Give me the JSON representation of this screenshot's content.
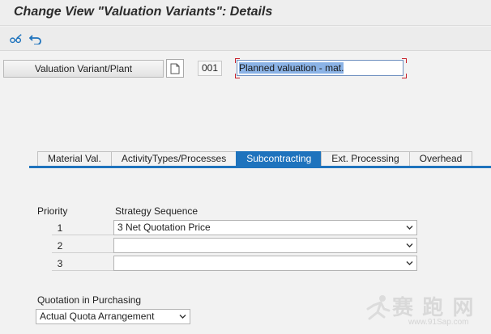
{
  "window": {
    "title": "Change View \"Valuation Variants\": Details"
  },
  "toolbar": {
    "icons": [
      "glasses-edit-icon",
      "undo-icon"
    ]
  },
  "header": {
    "variant_button_label": "Valuation Variant/Plant",
    "code": "001",
    "description": "Planned valuation - mat."
  },
  "tabs": [
    {
      "label": "Material Val.",
      "active": false
    },
    {
      "label": "ActivityTypes/Processes",
      "active": false
    },
    {
      "label": "Subcontracting",
      "active": true
    },
    {
      "label": "Ext. Processing",
      "active": false
    },
    {
      "label": "Overhead",
      "active": false
    }
  ],
  "subcontracting": {
    "priority_label": "Priority",
    "strategy_label": "Strategy Sequence",
    "rows": [
      {
        "priority": "1",
        "strategy": "3 Net Quotation Price"
      },
      {
        "priority": "2",
        "strategy": ""
      },
      {
        "priority": "3",
        "strategy": ""
      }
    ],
    "quotation_label": "Quotation in Purchasing",
    "quotation_value": "Actual Quota Arrangement"
  },
  "watermark": {
    "text": "赛 跑 网",
    "sub": "www.91Sap.com"
  },
  "colors": {
    "accent": "#1e73bd",
    "selection": "#8bb3e6",
    "required_marker": "#c8202a"
  }
}
